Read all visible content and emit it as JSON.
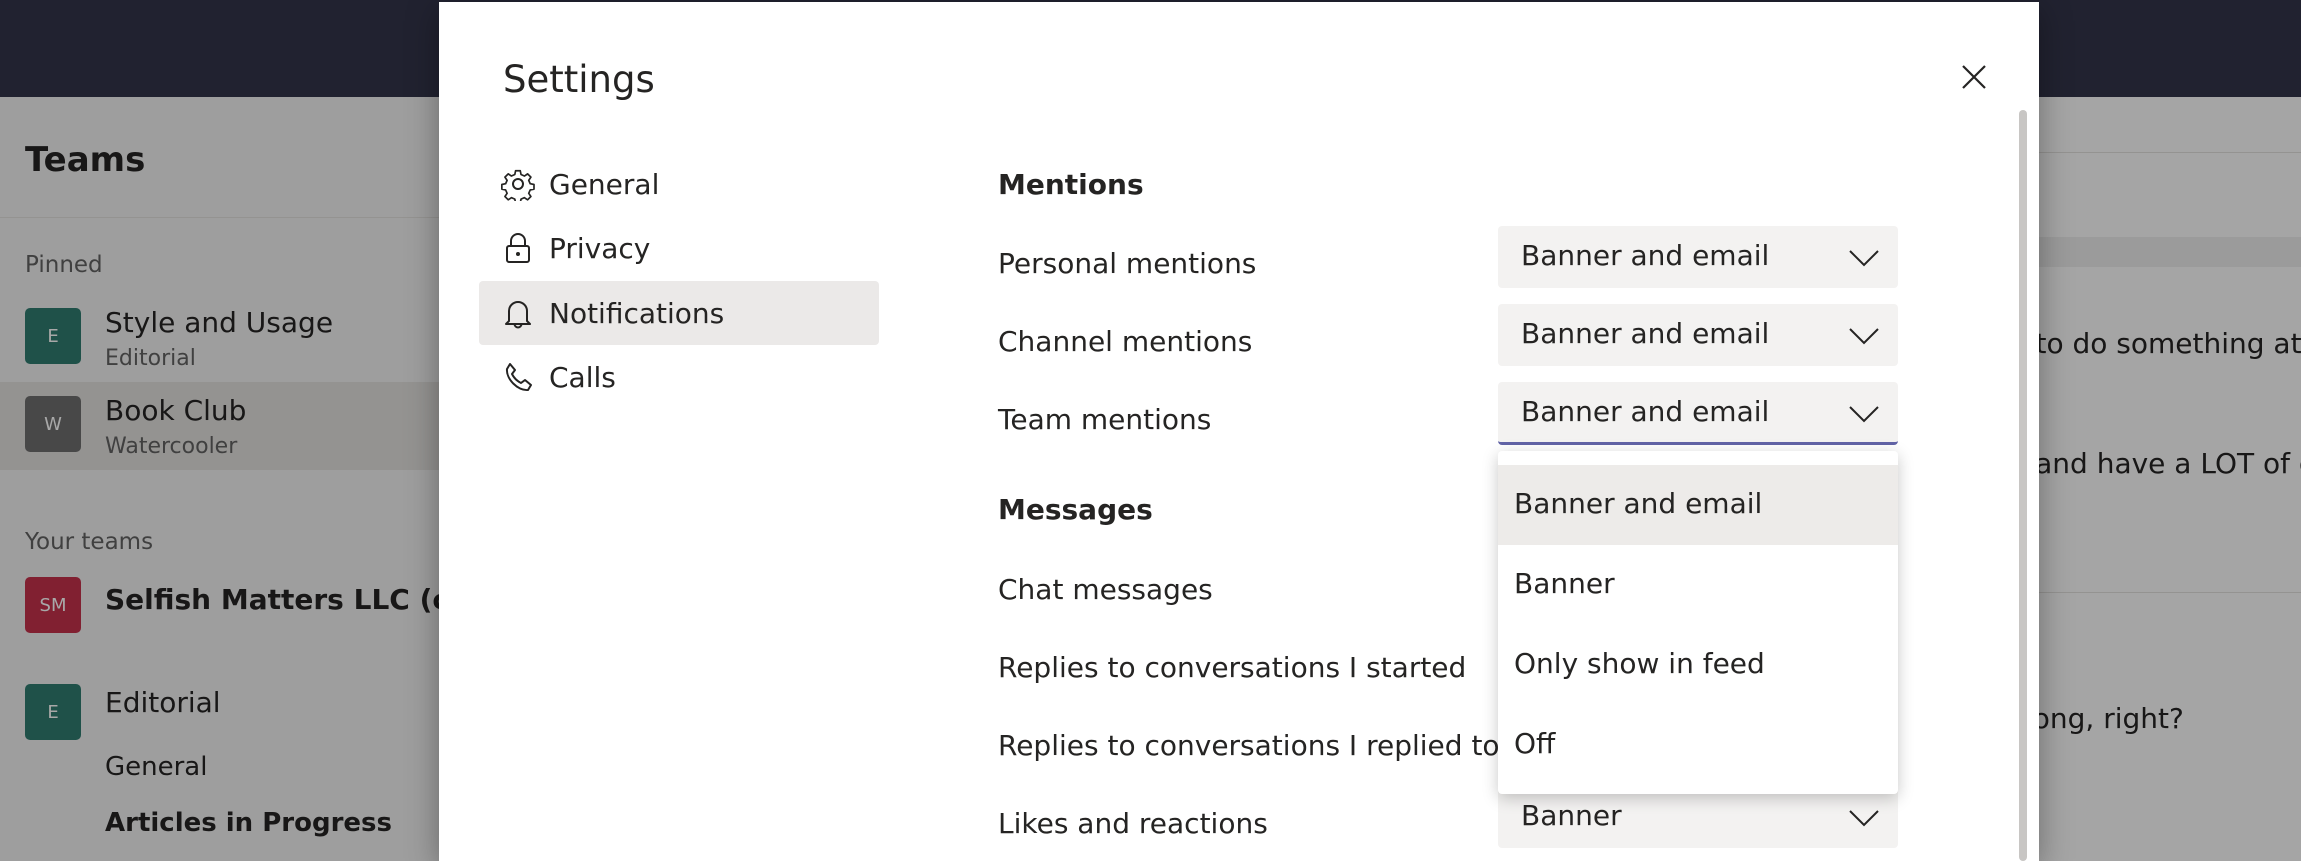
{
  "app": {
    "rail_title": "Teams",
    "pinned_label": "Pinned",
    "your_teams_label": "Your teams",
    "pinned": [
      {
        "initial": "E",
        "name": "Style and Usage",
        "sub": "Editorial",
        "color": "#2f7b70"
      },
      {
        "initial": "W",
        "name": "Book Club",
        "sub": "Watercooler",
        "color": "#6e6e6e"
      }
    ],
    "teams": [
      {
        "initial": "SM",
        "name": "Selfish Matters LLC (comp",
        "color": "#c4314b"
      },
      {
        "initial": "E",
        "name": "Editorial",
        "color": "#2f7b70"
      }
    ],
    "channels": [
      "General",
      "Articles in Progress"
    ],
    "messages": [
      "y to do something at",
      "k and have a LOT of c",
      "long, right?"
    ]
  },
  "dialog": {
    "title": "Settings",
    "close_icon": "close-icon",
    "nav": [
      {
        "label": "General",
        "icon": "gear-icon"
      },
      {
        "label": "Privacy",
        "icon": "lock-icon"
      },
      {
        "label": "Notifications",
        "icon": "bell-icon",
        "active": true
      },
      {
        "label": "Calls",
        "icon": "phone-icon"
      }
    ],
    "mentions_title": "Mentions",
    "messages_title": "Messages",
    "settings": {
      "personal_mentions": {
        "label": "Personal mentions",
        "value": "Banner and email"
      },
      "channel_mentions": {
        "label": "Channel mentions",
        "value": "Banner and email"
      },
      "team_mentions": {
        "label": "Team mentions",
        "value": "Banner and email"
      },
      "chat_messages": {
        "label": "Chat messages"
      },
      "replies_started": {
        "label": "Replies to conversations I started"
      },
      "replies_replied": {
        "label": "Replies to conversations I replied to"
      },
      "likes_reactions": {
        "label": "Likes and reactions",
        "value": "Banner"
      }
    },
    "dropdown_options": [
      "Banner and email",
      "Banner",
      "Only show in feed",
      "Off"
    ],
    "accent_color": "#6264a7"
  }
}
